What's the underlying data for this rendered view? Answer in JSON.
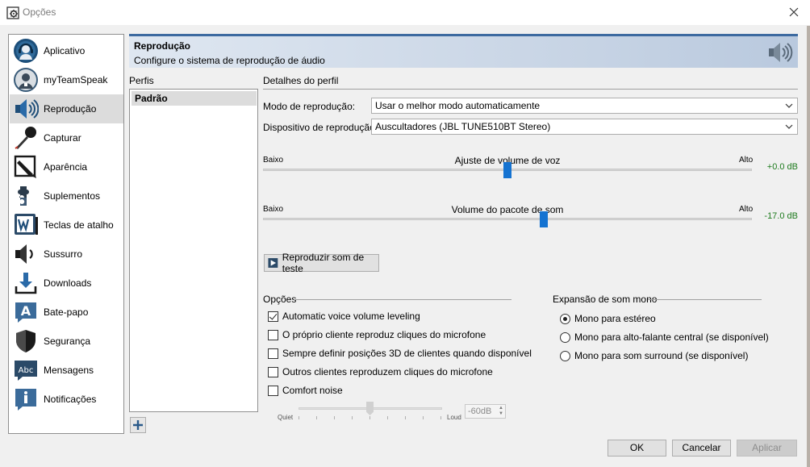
{
  "window": {
    "title": "Opções"
  },
  "sidebar": {
    "items": [
      {
        "label": "Aplicativo",
        "icon": "headset-icon"
      },
      {
        "label": "myTeamSpeak",
        "icon": "user-icon"
      },
      {
        "label": "Reprodução",
        "icon": "speaker-icon",
        "selected": true
      },
      {
        "label": "Capturar",
        "icon": "microphone-icon"
      },
      {
        "label": "Aparência",
        "icon": "brush-icon"
      },
      {
        "label": "Suplementos",
        "icon": "puzzle-icon"
      },
      {
        "label": "Teclas de atalho",
        "icon": "keyboard-w-icon"
      },
      {
        "label": "Sussurro",
        "icon": "whisper-speaker-icon"
      },
      {
        "label": "Downloads",
        "icon": "download-icon"
      },
      {
        "label": "Bate-papo",
        "icon": "chat-a-icon"
      },
      {
        "label": "Segurança",
        "icon": "shield-icon"
      },
      {
        "label": "Mensagens",
        "icon": "message-abc-icon"
      },
      {
        "label": "Notificações",
        "icon": "info-icon"
      }
    ]
  },
  "header": {
    "title": "Reprodução",
    "subtitle": "Configure o sistema de reprodução de áudio"
  },
  "profiles": {
    "label": "Perfis",
    "items": [
      "Padrão"
    ]
  },
  "details": {
    "label": "Detalhes do perfil",
    "mode_label": "Modo de reprodução:",
    "mode_value": "Usar o melhor modo automaticamente",
    "device_label": "Dispositivo de reprodução:",
    "device_value": "Auscultadores (JBL TUNE510BT Stereo)",
    "voice_slider": {
      "low": "Baixo",
      "high": "Alto",
      "title": "Ajuste de volume de voz",
      "value": "+0.0 dB",
      "level": 0.5
    },
    "sound_slider": {
      "low": "Baixo",
      "high": "Alto",
      "title": "Volume do pacote de som",
      "value": "-17.0 dB",
      "level": 0.575
    },
    "test_button": "Reproduzir som de teste"
  },
  "options": {
    "title": "Opções",
    "checks": [
      {
        "label": "Automatic voice volume leveling",
        "checked": true
      },
      {
        "label": "O próprio cliente reproduz cliques do microfone",
        "checked": false
      },
      {
        "label": "Sempre definir posições 3D de clientes quando disponível",
        "checked": false
      },
      {
        "label": "Outros clientes reproduzem cliques do microfone",
        "checked": false
      },
      {
        "label": "Comfort noise",
        "checked": false
      }
    ],
    "comfort": {
      "quiet": "Quiet",
      "loud": "Loud",
      "value": "-60dB"
    }
  },
  "mono": {
    "title": "Expansão de som mono",
    "radios": [
      {
        "label": "Mono para estéreo",
        "checked": true
      },
      {
        "label": "Mono para alto-falante central (se disponível)",
        "checked": false
      },
      {
        "label": "Mono para som surround (se disponível)",
        "checked": false
      }
    ]
  },
  "footer": {
    "ok": "OK",
    "cancel": "Cancelar",
    "apply": "Aplicar"
  },
  "colors": {
    "accent": "#1573d1",
    "positive": "#1c7a1c",
    "banner_border": "#3d6aa0"
  }
}
